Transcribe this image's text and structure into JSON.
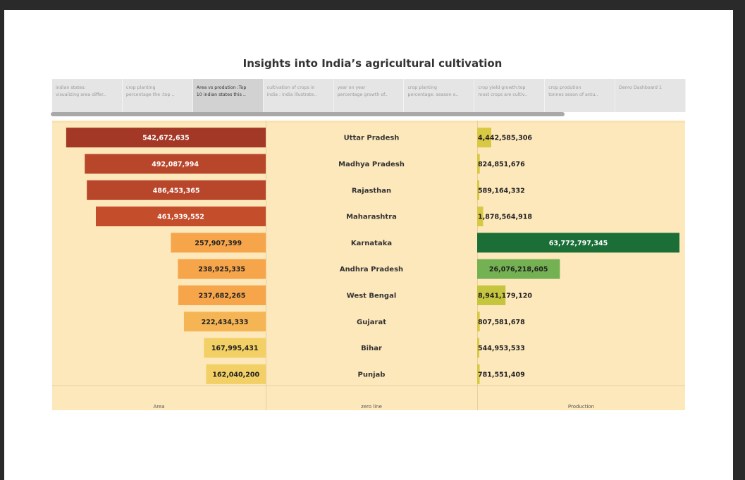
{
  "title": "Insights into India’s agricultural cultivation",
  "tabs": [
    {
      "line1": "indian states:",
      "line2": "visualizing area differ..",
      "active": false
    },
    {
      "line1": "crop planting",
      "line2": "percentage the :top ..",
      "active": false
    },
    {
      "line1": "Area vs prodution :Top",
      "line2": "10 indian states this ..",
      "active": true
    },
    {
      "line1": "cultivation of crops in",
      "line2": "india : india illustrate..",
      "active": false
    },
    {
      "line1": "year on year",
      "line2": "percentage growth of..",
      "active": false
    },
    {
      "line1": "crop planting",
      "line2": "percentage: season o..",
      "active": false
    },
    {
      "line1": "crop yield growth:top",
      "line2": "most crops are cultiv..",
      "active": false
    },
    {
      "line1": "crop prodution",
      "line2": "tonnes seson of antu..",
      "active": false
    },
    {
      "line1": "Demo Dashboard 1",
      "line2": "",
      "active": false
    }
  ],
  "chart_data": {
    "type": "bar",
    "categories": [
      "Uttar Pradesh",
      "Madhya Pradesh",
      "Rajasthan",
      "Maharashtra",
      "Karnataka",
      "Andhra Pradesh",
      "West Bengal",
      "Gujarat",
      "Bihar",
      "Punjab"
    ],
    "series": [
      {
        "name": "Area",
        "values": [
          542672635,
          492087994,
          486453365,
          461939552,
          257907399,
          238925335,
          237682265,
          222434333,
          167995431,
          162040200
        ],
        "labels": [
          "542,672,635",
          "492,087,994",
          "486,453,365",
          "461,939,552",
          "257,907,399",
          "238,925,335",
          "237,682,265",
          "222,434,333",
          "167,995,431",
          "162,040,200"
        ],
        "colors": [
          "#a33826",
          "#b8462a",
          "#b8462a",
          "#c44d2c",
          "#f6a54b",
          "#f6a54b",
          "#f6a54b",
          "#f6b555",
          "#f2d065",
          "#f2d065"
        ],
        "label_colors": [
          "#ffffff",
          "#ffffff",
          "#ffffff",
          "#ffffff",
          "#222222",
          "#222222",
          "#222222",
          "#222222",
          "#222222",
          "#222222"
        ]
      },
      {
        "name": "Production",
        "values": [
          4442585306,
          824851676,
          589164332,
          1878564918,
          63772797345,
          26076218605,
          8941179120,
          807581678,
          544953533,
          781551409
        ],
        "labels": [
          "4,442,585,306",
          "824,851,676",
          "589,164,332",
          "1,878,564,918",
          "63,772,797,345",
          "26,076,218,605",
          "8,941,179,120",
          "807,581,678",
          "544,953,533",
          "781,551,409"
        ],
        "colors": [
          "#d9c844",
          "#d9c844",
          "#d9c844",
          "#d9c844",
          "#1a6e36",
          "#74b152",
          "#c6c53e",
          "#d9c844",
          "#d9c844",
          "#d9c844"
        ],
        "label_colors": [
          "#222222",
          "#222222",
          "#222222",
          "#222222",
          "#ffffff",
          "#222222",
          "#222222",
          "#222222",
          "#222222",
          "#222222"
        ]
      }
    ],
    "columns": [
      "Area",
      "zero line",
      "Production"
    ],
    "xlim_area": [
      0,
      575000000
    ],
    "xlim_production": [
      0,
      63772797345
    ]
  }
}
